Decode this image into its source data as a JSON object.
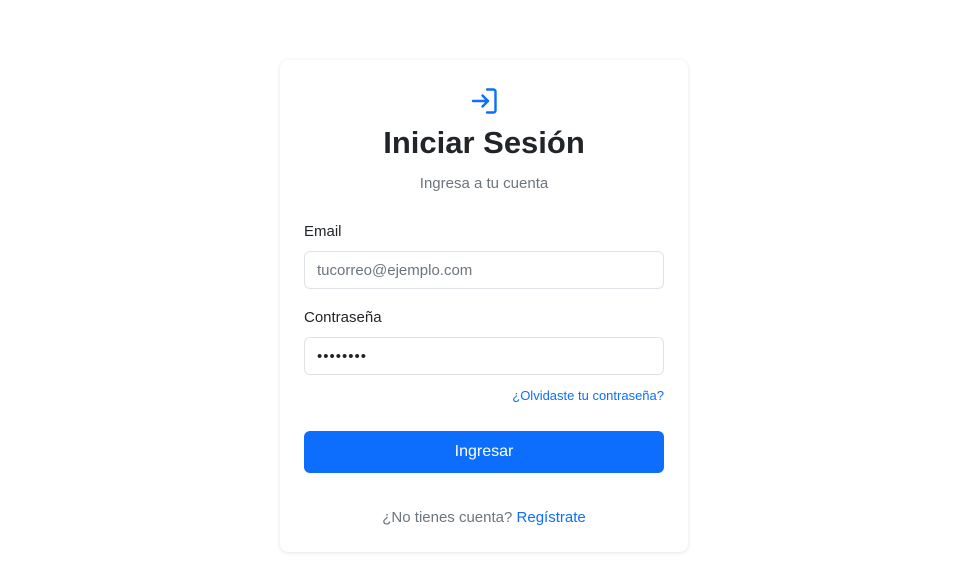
{
  "header": {
    "icon": "login-icon",
    "title": "Iniciar Sesión",
    "subtitle": "Ingresa a tu cuenta"
  },
  "form": {
    "email_label": "Email",
    "email_placeholder": "tucorreo@ejemplo.com",
    "email_value": "",
    "password_label": "Contraseña",
    "password_value": "••••••••",
    "forgot_link": "¿Olvidaste tu contraseña?",
    "submit_label": "Ingresar"
  },
  "footer": {
    "prompt": "¿No tienes cuenta?",
    "signup_link": "Regístrate"
  },
  "colors": {
    "primary": "#0d6efd",
    "muted_text": "#6c757d",
    "border": "#dee2e6"
  }
}
